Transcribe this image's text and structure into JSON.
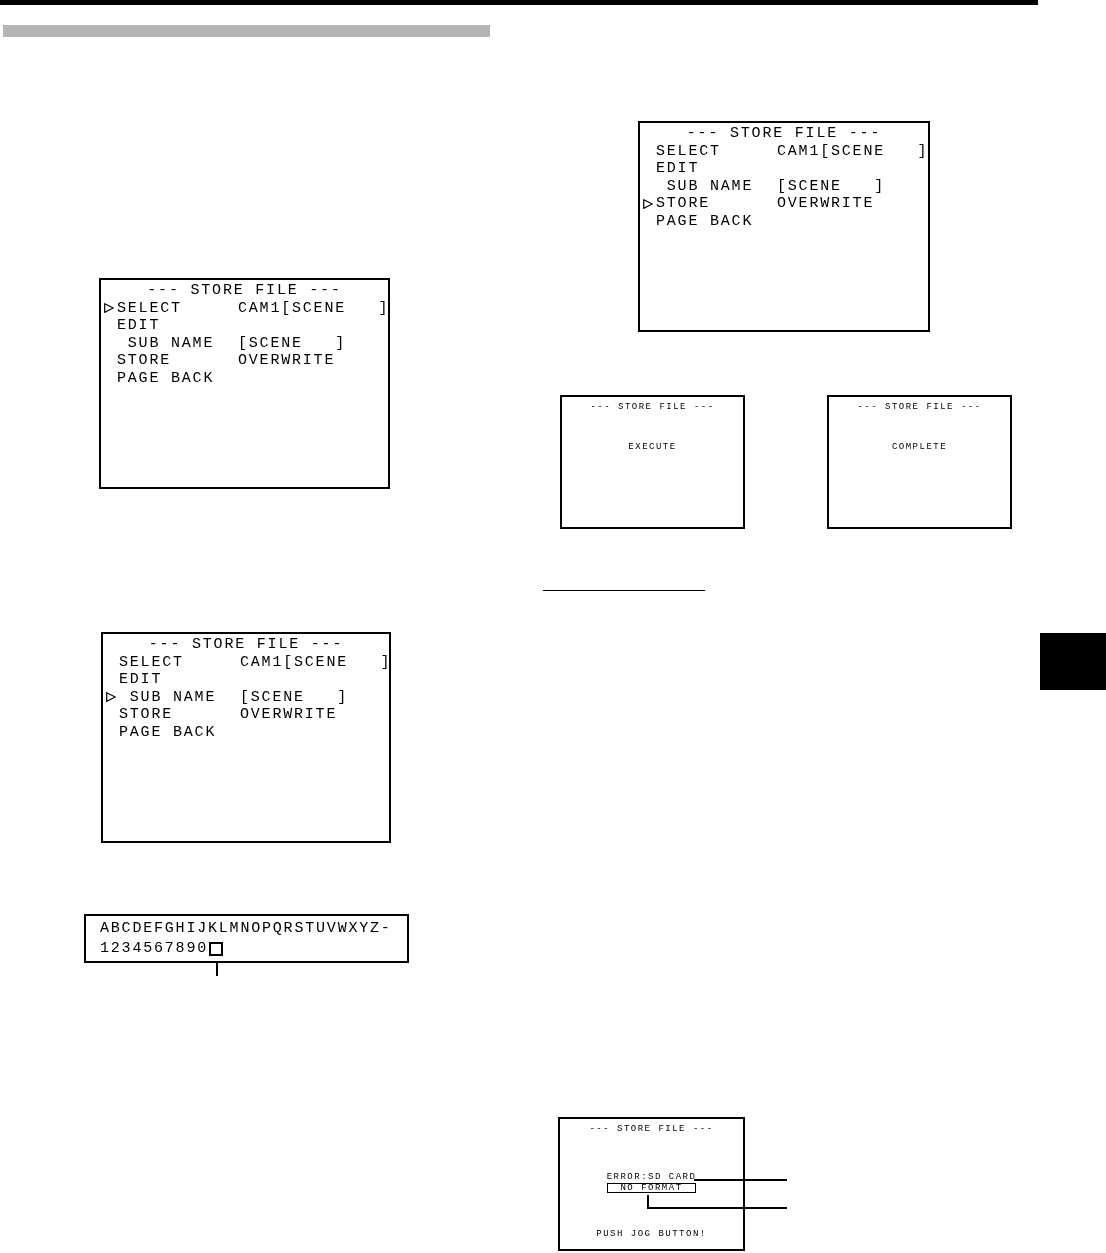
{
  "left": {
    "menu_screens": [
      {
        "title": "--- STORE FILE ---",
        "rows": [
          {
            "label": "SELECT",
            "value": "CAM1[SCENE   ]",
            "selected": true
          },
          {
            "label": "EDIT",
            "selected": false,
            "children": [
              {
                "label": "SUB NAME",
                "value": "[SCENE   ]",
                "selected": false
              }
            ]
          },
          {
            "label": "STORE",
            "value": "OVERWRITE",
            "selected": false
          },
          {
            "label": "PAGE BACK",
            "selected": false
          }
        ]
      },
      {
        "title": "--- STORE FILE ---",
        "rows": [
          {
            "label": "SELECT",
            "value": "CAM1[SCENE   ]",
            "selected": false
          },
          {
            "label": "EDIT",
            "selected": false,
            "children": [
              {
                "label": "SUB NAME",
                "value": "[SCENE   ]",
                "selected": true
              }
            ]
          },
          {
            "label": "STORE",
            "value": "OVERWRITE",
            "selected": false
          },
          {
            "label": "PAGE BACK",
            "selected": false
          }
        ]
      }
    ],
    "character_table": {
      "rows": [
        {
          "characters": "ABCDEFGHIJKLMNOPQRSTUVWXYZ-",
          "cursor_on_space": false
        },
        {
          "characters": "1234567890",
          "cursor_on_space": true
        }
      ]
    }
  },
  "right": {
    "menu_screen": {
      "title": "--- STORE FILE ---",
      "rows": [
        {
          "label": "SELECT",
          "value": "CAM1[SCENE   ]",
          "selected": false
        },
        {
          "label": "EDIT",
          "selected": false,
          "children": [
            {
              "label": "SUB NAME",
              "value": "[SCENE   ]",
              "selected": false
            }
          ]
        },
        {
          "label": "STORE",
          "value": "OVERWRITE",
          "selected": true
        },
        {
          "label": "PAGE BACK",
          "selected": false
        }
      ]
    },
    "message_screens": [
      {
        "title": "--- STORE FILE ---",
        "message": "EXECUTE"
      },
      {
        "title": "--- STORE FILE ---",
        "message": "COMPLETE"
      }
    ],
    "error_screen": {
      "title": "--- STORE FILE ---",
      "lines": [
        {
          "kind": "error",
          "text": "ERROR:SD CARD"
        },
        {
          "kind": "boxed",
          "text": "NO FORMAT"
        },
        {
          "kind": "prompt",
          "text": "PUSH JOG BUTTON!"
        }
      ]
    }
  }
}
